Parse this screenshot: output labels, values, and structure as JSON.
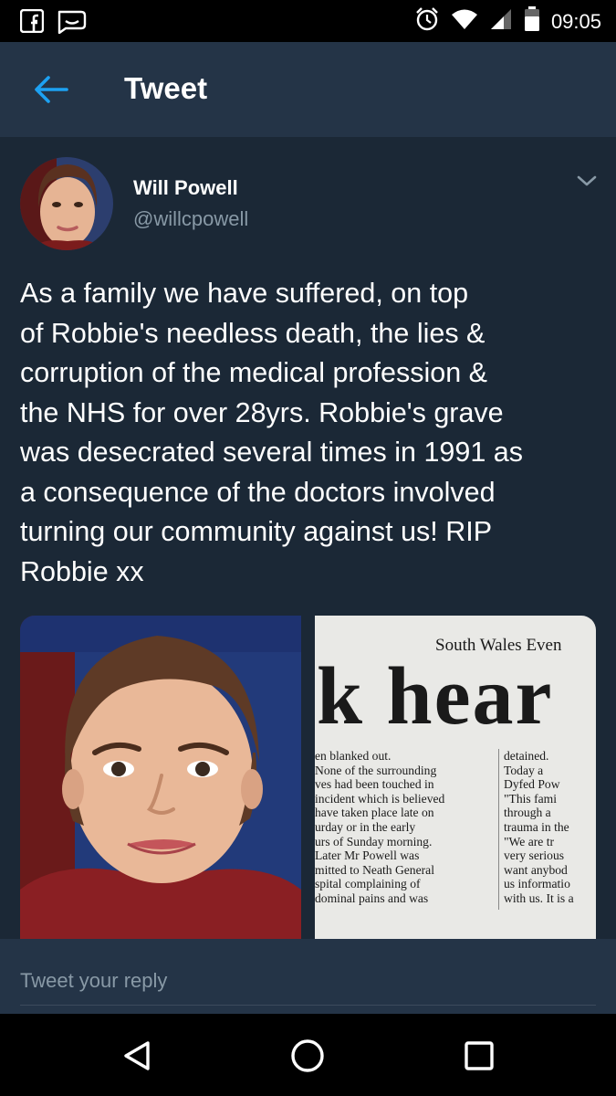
{
  "status_bar": {
    "time": "09:05",
    "left_icons": [
      "facebook-icon",
      "messages-icon"
    ],
    "right_icons": [
      "alarm-icon",
      "wifi-icon",
      "signal-icon",
      "battery-icon"
    ]
  },
  "app_bar": {
    "title": "Tweet",
    "back_icon": "arrow-left-icon"
  },
  "tweet": {
    "author_name": "Will Powell",
    "author_handle": "@willcpowell",
    "text_lines": [
      "As a family we have suffered, on top",
      "of Robbie's needless death, the lies &",
      "corruption of the medical profession &",
      "the NHS for over 28yrs. Robbie's grave",
      "was desecrated several times in 1991 as",
      "a consequence of the doctors involved",
      "turning our community against us! RIP",
      "Robbie xx"
    ],
    "media": {
      "clipping": {
        "masthead": "South Wales Even",
        "headline": "k hear",
        "left_column": [
          "en blanked out.",
          "None of the surrounding",
          "ves had been touched in",
          "incident which is believed",
          "have taken place late on",
          "urday or in the early",
          "urs of Sunday morning.",
          "Later Mr Powell was",
          "mitted to Neath General",
          "spital complaining of",
          "dominal pains and was"
        ],
        "right_column": [
          "detained.",
          "Today a",
          "Dyfed Pow",
          "\"This fami",
          "through a",
          "trauma in the",
          "\"We are tr",
          "very serious",
          "want anybod",
          "us informatio",
          "with us. It is a"
        ]
      }
    }
  },
  "reply": {
    "placeholder": "Tweet your reply"
  },
  "colors": {
    "accent": "#1da1f2",
    "background": "#141d26",
    "tweet_background": "#1b2836",
    "app_bar": "#243447",
    "secondary_text": "#8899a6"
  }
}
